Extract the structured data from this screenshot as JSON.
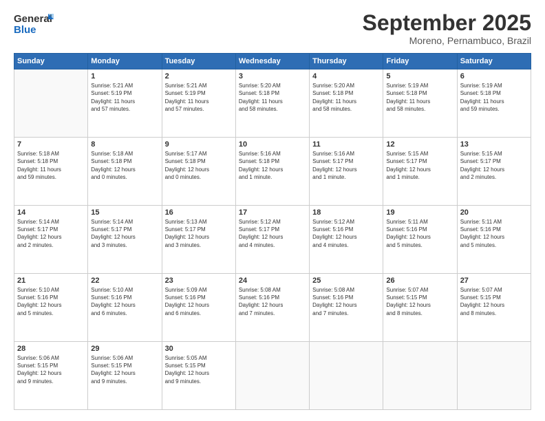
{
  "header": {
    "logo_general": "General",
    "logo_blue": "Blue",
    "month": "September 2025",
    "location": "Moreno, Pernambuco, Brazil"
  },
  "weekdays": [
    "Sunday",
    "Monday",
    "Tuesday",
    "Wednesday",
    "Thursday",
    "Friday",
    "Saturday"
  ],
  "weeks": [
    [
      {
        "day": "",
        "info": ""
      },
      {
        "day": "1",
        "info": "Sunrise: 5:21 AM\nSunset: 5:19 PM\nDaylight: 11 hours\nand 57 minutes."
      },
      {
        "day": "2",
        "info": "Sunrise: 5:21 AM\nSunset: 5:19 PM\nDaylight: 11 hours\nand 57 minutes."
      },
      {
        "day": "3",
        "info": "Sunrise: 5:20 AM\nSunset: 5:18 PM\nDaylight: 11 hours\nand 58 minutes."
      },
      {
        "day": "4",
        "info": "Sunrise: 5:20 AM\nSunset: 5:18 PM\nDaylight: 11 hours\nand 58 minutes."
      },
      {
        "day": "5",
        "info": "Sunrise: 5:19 AM\nSunset: 5:18 PM\nDaylight: 11 hours\nand 58 minutes."
      },
      {
        "day": "6",
        "info": "Sunrise: 5:19 AM\nSunset: 5:18 PM\nDaylight: 11 hours\nand 59 minutes."
      }
    ],
    [
      {
        "day": "7",
        "info": "Sunrise: 5:18 AM\nSunset: 5:18 PM\nDaylight: 11 hours\nand 59 minutes."
      },
      {
        "day": "8",
        "info": "Sunrise: 5:18 AM\nSunset: 5:18 PM\nDaylight: 12 hours\nand 0 minutes."
      },
      {
        "day": "9",
        "info": "Sunrise: 5:17 AM\nSunset: 5:18 PM\nDaylight: 12 hours\nand 0 minutes."
      },
      {
        "day": "10",
        "info": "Sunrise: 5:16 AM\nSunset: 5:18 PM\nDaylight: 12 hours\nand 1 minute."
      },
      {
        "day": "11",
        "info": "Sunrise: 5:16 AM\nSunset: 5:17 PM\nDaylight: 12 hours\nand 1 minute."
      },
      {
        "day": "12",
        "info": "Sunrise: 5:15 AM\nSunset: 5:17 PM\nDaylight: 12 hours\nand 1 minute."
      },
      {
        "day": "13",
        "info": "Sunrise: 5:15 AM\nSunset: 5:17 PM\nDaylight: 12 hours\nand 2 minutes."
      }
    ],
    [
      {
        "day": "14",
        "info": "Sunrise: 5:14 AM\nSunset: 5:17 PM\nDaylight: 12 hours\nand 2 minutes."
      },
      {
        "day": "15",
        "info": "Sunrise: 5:14 AM\nSunset: 5:17 PM\nDaylight: 12 hours\nand 3 minutes."
      },
      {
        "day": "16",
        "info": "Sunrise: 5:13 AM\nSunset: 5:17 PM\nDaylight: 12 hours\nand 3 minutes."
      },
      {
        "day": "17",
        "info": "Sunrise: 5:12 AM\nSunset: 5:17 PM\nDaylight: 12 hours\nand 4 minutes."
      },
      {
        "day": "18",
        "info": "Sunrise: 5:12 AM\nSunset: 5:16 PM\nDaylight: 12 hours\nand 4 minutes."
      },
      {
        "day": "19",
        "info": "Sunrise: 5:11 AM\nSunset: 5:16 PM\nDaylight: 12 hours\nand 5 minutes."
      },
      {
        "day": "20",
        "info": "Sunrise: 5:11 AM\nSunset: 5:16 PM\nDaylight: 12 hours\nand 5 minutes."
      }
    ],
    [
      {
        "day": "21",
        "info": "Sunrise: 5:10 AM\nSunset: 5:16 PM\nDaylight: 12 hours\nand 5 minutes."
      },
      {
        "day": "22",
        "info": "Sunrise: 5:10 AM\nSunset: 5:16 PM\nDaylight: 12 hours\nand 6 minutes."
      },
      {
        "day": "23",
        "info": "Sunrise: 5:09 AM\nSunset: 5:16 PM\nDaylight: 12 hours\nand 6 minutes."
      },
      {
        "day": "24",
        "info": "Sunrise: 5:08 AM\nSunset: 5:16 PM\nDaylight: 12 hours\nand 7 minutes."
      },
      {
        "day": "25",
        "info": "Sunrise: 5:08 AM\nSunset: 5:16 PM\nDaylight: 12 hours\nand 7 minutes."
      },
      {
        "day": "26",
        "info": "Sunrise: 5:07 AM\nSunset: 5:15 PM\nDaylight: 12 hours\nand 8 minutes."
      },
      {
        "day": "27",
        "info": "Sunrise: 5:07 AM\nSunset: 5:15 PM\nDaylight: 12 hours\nand 8 minutes."
      }
    ],
    [
      {
        "day": "28",
        "info": "Sunrise: 5:06 AM\nSunset: 5:15 PM\nDaylight: 12 hours\nand 9 minutes."
      },
      {
        "day": "29",
        "info": "Sunrise: 5:06 AM\nSunset: 5:15 PM\nDaylight: 12 hours\nand 9 minutes."
      },
      {
        "day": "30",
        "info": "Sunrise: 5:05 AM\nSunset: 5:15 PM\nDaylight: 12 hours\nand 9 minutes."
      },
      {
        "day": "",
        "info": ""
      },
      {
        "day": "",
        "info": ""
      },
      {
        "day": "",
        "info": ""
      },
      {
        "day": "",
        "info": ""
      }
    ]
  ]
}
